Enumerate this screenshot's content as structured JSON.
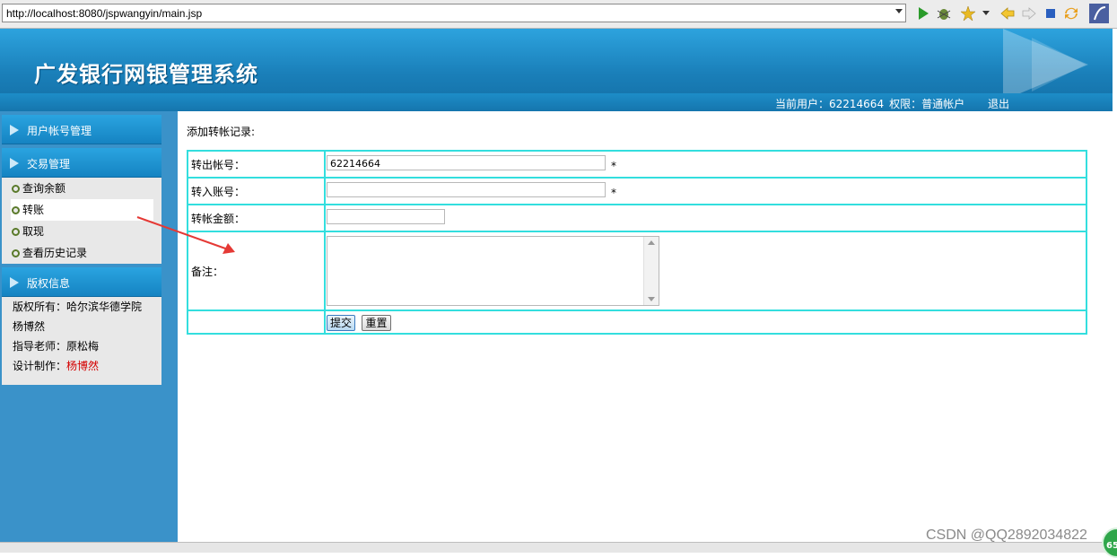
{
  "browser": {
    "url": "http://localhost:8080/jspwangyin/main.jsp"
  },
  "header": {
    "title": "广发银行网银管理系统",
    "current_user_label": "当前用户：62214664",
    "permission_label": "权限：普通帐户",
    "logout_label": "退出"
  },
  "sidebar": {
    "account_menu": "用户帐号管理",
    "transaction_menu": "交易管理",
    "transaction_items": [
      "查询余额",
      "转账",
      "取现",
      "查看历史记录"
    ],
    "copyright_menu": "版权信息",
    "copyright_lines": {
      "owner": "版权所有：哈尔滨华德学院",
      "name": "杨博然",
      "teacher": "指导老师：原松梅",
      "designer_label": "设计制作：",
      "designer_name": "杨博然"
    }
  },
  "main": {
    "form_title": "添加转帐记录:",
    "fields": {
      "from_account_label": "转出帐号：",
      "from_account_value": "62214664",
      "to_account_label": "转入账号：",
      "to_account_value": "",
      "amount_label": "转帐金额：",
      "amount_value": "",
      "remark_label": "备注：",
      "required_mark": "*"
    },
    "submit_label": "提交",
    "reset_label": "重置"
  },
  "watermark": "CSDN @QQ2892034822",
  "badge": "65",
  "colors": {
    "banner": "#1a7fb9",
    "sidebar": "#3a92c9",
    "table_border": "#33dede",
    "highlight": "#d40000",
    "annotation_arrow": "#e53935"
  }
}
